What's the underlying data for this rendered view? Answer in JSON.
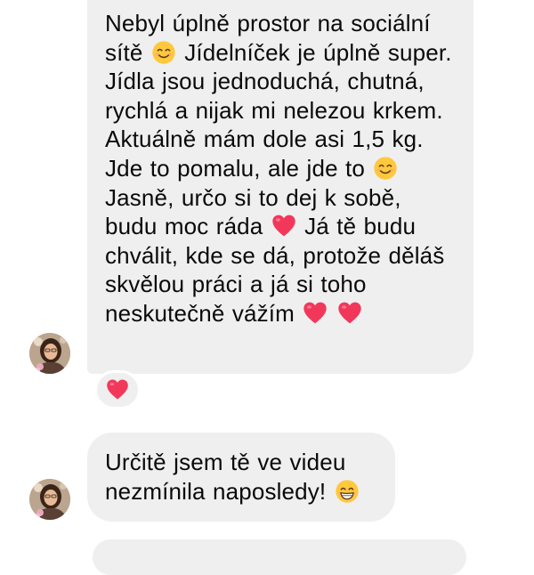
{
  "messages": [
    {
      "parts": [
        {
          "type": "text",
          "value": "Nebyl úplně prostor na sociální sítě "
        },
        {
          "type": "emoji",
          "name": "smiling-face-icon"
        },
        {
          "type": "text",
          "value": " Jídelníček je úplně super. Jídla jsou jednoduchá, chutná, rychlá a nijak mi nelezou krkem. Aktuálně mám dole asi 1,5 kg. Jde to pomalu, ale jde to "
        },
        {
          "type": "emoji",
          "name": "smiling-face-icon"
        },
        {
          "type": "text",
          "value": " Jasně, určo si to dej k sobě, budu moc ráda "
        },
        {
          "type": "emoji",
          "name": "heart-icon"
        },
        {
          "type": "text",
          "value": " Já tě budu chválit, kde se dá, protože děláš skvělou práci a já si toho neskutečně vážím "
        },
        {
          "type": "emoji",
          "name": "heart-icon"
        },
        {
          "type": "text",
          "value": " "
        },
        {
          "type": "emoji",
          "name": "heart-icon"
        }
      ],
      "reaction": "heart-icon"
    },
    {
      "parts": [
        {
          "type": "text",
          "value": "Určitě jsem tě ve videu nezmínila naposledy! "
        },
        {
          "type": "emoji",
          "name": "grinning-face-icon"
        }
      ]
    }
  ],
  "colors": {
    "bubble": "#efefef",
    "heart": "#f2385a",
    "emoji_face": "#ffc83d"
  }
}
